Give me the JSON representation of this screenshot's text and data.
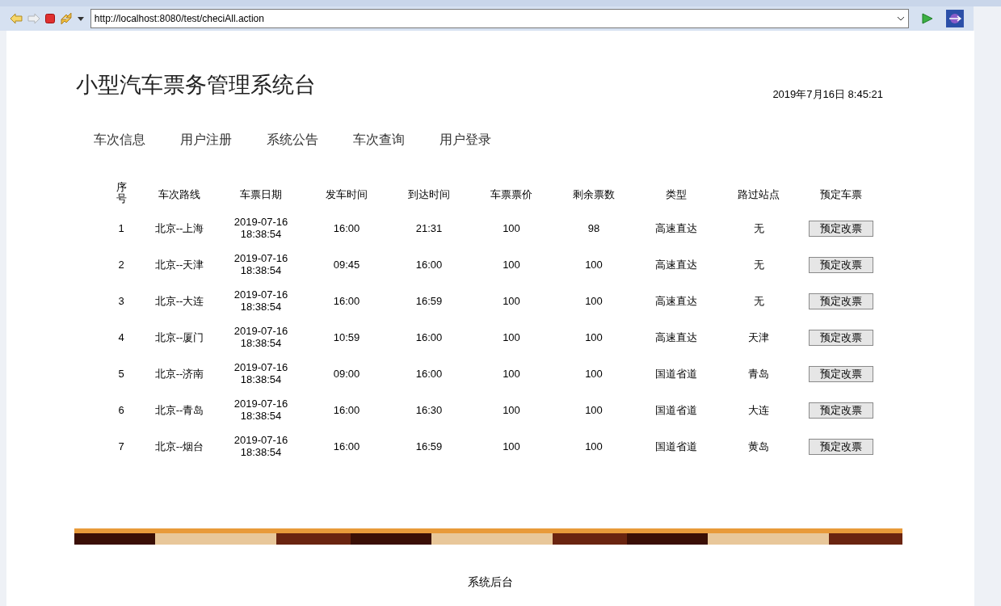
{
  "browser": {
    "url": "http://localhost:8080/test/checiAll.action"
  },
  "page": {
    "title": "小型汽车票务管理系统台",
    "datetime": "2019年7月16日 8:45:21",
    "nav": [
      {
        "label": "车次信息"
      },
      {
        "label": "用户注册"
      },
      {
        "label": "系统公告"
      },
      {
        "label": "车次查询"
      },
      {
        "label": "用户登录"
      }
    ],
    "table": {
      "columns": [
        "序号",
        "车次路线",
        "车票日期",
        "发车时间",
        "到达时间",
        "车票票价",
        "剩余票数",
        "类型",
        "路过站点",
        "预定车票"
      ],
      "rows": [
        {
          "cells": [
            "1",
            "北京--上海",
            "2019-07-16 18:38:54",
            "16:00",
            "21:31",
            "100",
            "98",
            "高速直达",
            "无"
          ],
          "button": "预定改票"
        },
        {
          "cells": [
            "2",
            "北京--天津",
            "2019-07-16 18:38:54",
            "09:45",
            "16:00",
            "100",
            "100",
            "高速直达",
            "无"
          ],
          "button": "预定改票"
        },
        {
          "cells": [
            "3",
            "北京--大连",
            "2019-07-16 18:38:54",
            "16:00",
            "16:59",
            "100",
            "100",
            "高速直达",
            "无"
          ],
          "button": "预定改票"
        },
        {
          "cells": [
            "4",
            "北京--厦门",
            "2019-07-16 18:38:54",
            "10:59",
            "16:00",
            "100",
            "100",
            "高速直达",
            "天津"
          ],
          "button": "预定改票"
        },
        {
          "cells": [
            "5",
            "北京--济南",
            "2019-07-16 18:38:54",
            "09:00",
            "16:00",
            "100",
            "100",
            "国道省道",
            "青岛"
          ],
          "button": "预定改票"
        },
        {
          "cells": [
            "6",
            "北京--青岛",
            "2019-07-16 18:38:54",
            "16:00",
            "16:30",
            "100",
            "100",
            "国道省道",
            "大连"
          ],
          "button": "预定改票"
        },
        {
          "cells": [
            "7",
            "北京--烟台",
            "2019-07-16 18:38:54",
            "16:00",
            "16:59",
            "100",
            "100",
            "国道省道",
            "黄岛"
          ],
          "button": "预定改票"
        }
      ]
    },
    "footer": {
      "link": "系统后台"
    }
  }
}
